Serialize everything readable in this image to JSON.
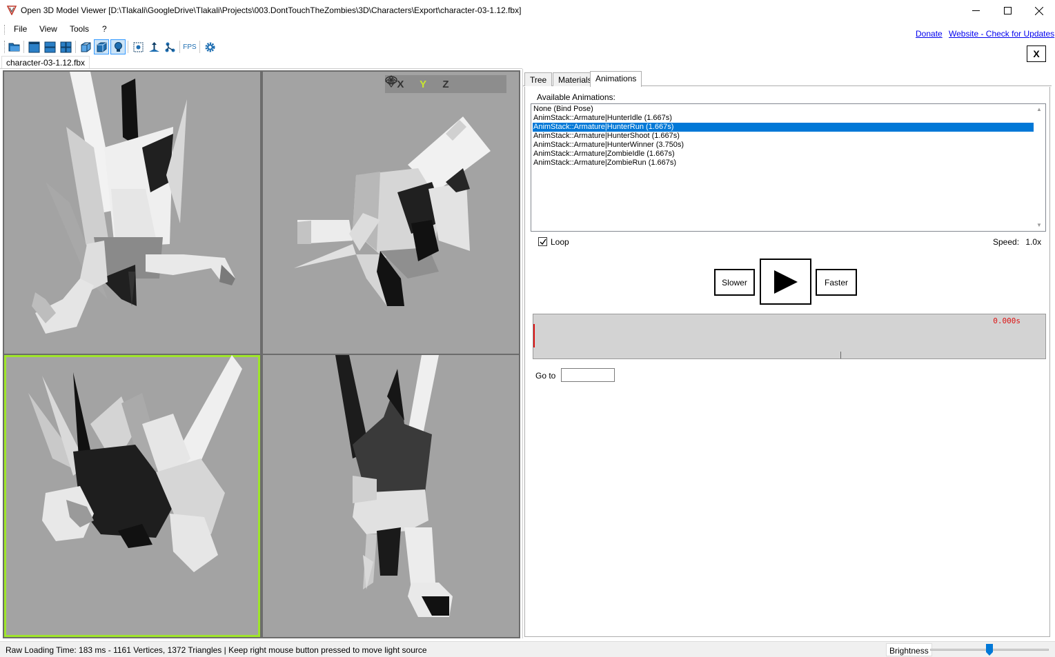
{
  "window": {
    "title": "Open 3D Model Viewer  [D:\\Tlakali\\GoogleDrive\\Tlakali\\Projects\\003.DontTouchTheZombies\\3D\\Characters\\Export\\character-03-1.12.fbx]",
    "minimize_icon": "minimize-icon",
    "maximize_icon": "maximize-icon",
    "close_icon": "close-icon"
  },
  "menu": {
    "items": [
      "File",
      "View",
      "Tools",
      "?"
    ],
    "donate": "Donate",
    "website": "Website - Check for Updates"
  },
  "toolbar": {
    "icons": [
      "open-folder-icon",
      "single-view-icon",
      "two-view-icon",
      "four-view-icon",
      "wireframe-icon",
      "shaded-icon",
      "light-bulb-icon",
      "center-icon",
      "normals-icon",
      "skeleton-icon",
      "fps-icon",
      "settings-icon"
    ],
    "fps_label": "FPS",
    "close_label": "X"
  },
  "document_tab": "character-03-1.12.fbx",
  "viewport_axes": [
    "X",
    "Y",
    "Z"
  ],
  "viewport_active_axis": "Y",
  "side_tabs": [
    "Tree",
    "Materials",
    "Animations"
  ],
  "active_side_tab": "Animations",
  "animations": {
    "label": "Available Animations:",
    "items": [
      "None (Bind Pose)",
      "AnimStack::Armature|HunterIdle (1.667s)",
      "AnimStack::Armature|HunterRun (1.667s)",
      "AnimStack::Armature|HunterShoot (1.667s)",
      "AnimStack::Armature|HunterWinner (3.750s)",
      "AnimStack::Armature|ZombieIdle (1.667s)",
      "AnimStack::Armature|ZombieRun (1.667s)"
    ],
    "selected_index": 2,
    "loop_label": "Loop",
    "loop_checked": true,
    "speed_label": "Speed:",
    "speed_value": "1.0x",
    "slower": "Slower",
    "faster": "Faster",
    "time": "0.000s",
    "goto_label": "Go to",
    "goto_value": ""
  },
  "status": {
    "text": "Raw Loading Time: 183 ms - 1161 Vertices, 1372 Triangles  | Keep right mouse button pressed to move light source",
    "brightness_label": "Brightness",
    "brightness_level": 0.5
  },
  "colors": {
    "selection": "#0078d7",
    "viewport_bg": "#a3a3a3",
    "active_viewport_border": "#9fe52a",
    "time_color": "#dd1111"
  }
}
